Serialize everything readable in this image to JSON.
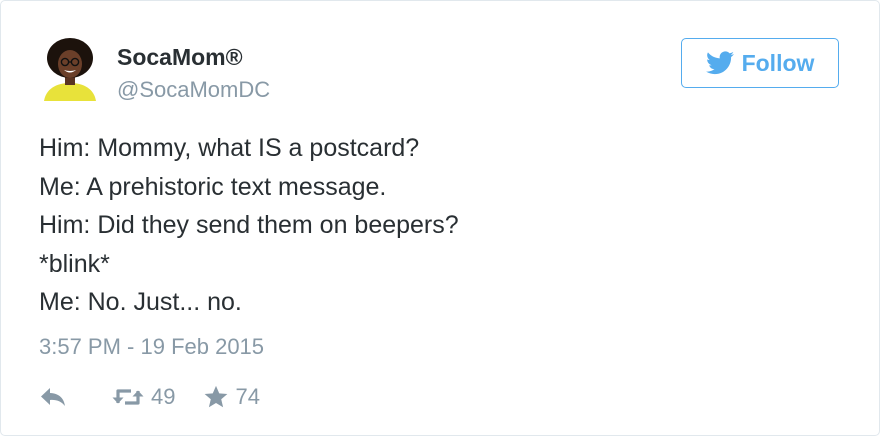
{
  "author": {
    "display_name": "SocaMom®",
    "handle": "@SocaMomDC"
  },
  "follow_button": {
    "label": "Follow",
    "icon": "twitter-bird-icon"
  },
  "tweet": {
    "lines": [
      "Him: Mommy, what IS a postcard?",
      "Me: A prehistoric text message.",
      "Him: Did they send them on beepers?",
      "*blink*",
      "Me: No. Just... no."
    ],
    "timestamp": "3:57 PM - 19 Feb 2015"
  },
  "actions": {
    "reply_icon": "reply-icon",
    "retweet_icon": "retweet-icon",
    "retweet_count": "49",
    "favorite_icon": "star-icon",
    "favorite_count": "74"
  },
  "colors": {
    "accent": "#55acee",
    "text": "#292f33",
    "muted": "#8899a6",
    "border": "#e1e8ed"
  }
}
